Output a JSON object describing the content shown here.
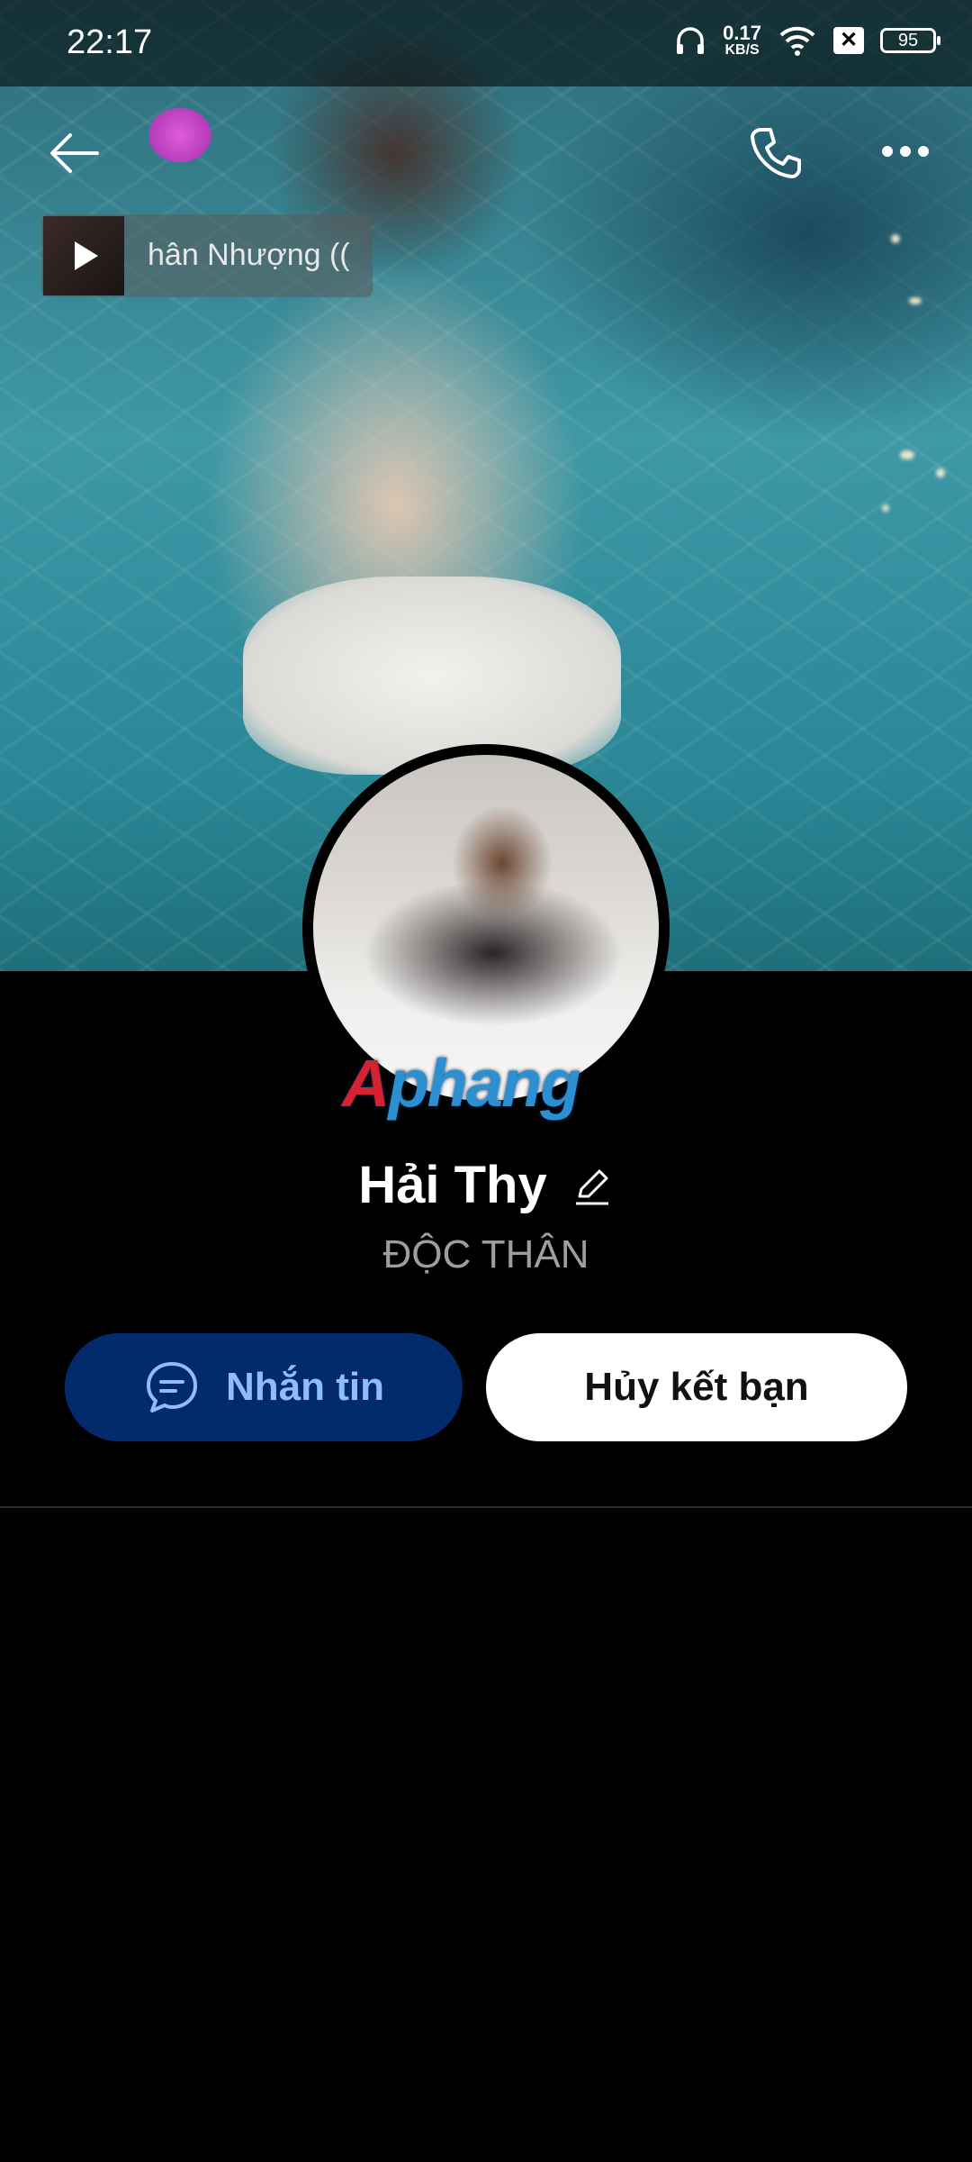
{
  "status_bar": {
    "time": "22:17",
    "net_speed_value": "0.17",
    "net_speed_unit": "KB/S",
    "battery": "95",
    "notification_icon": "x-box-icon"
  },
  "top_bar": {
    "back_icon": "arrow-left-icon",
    "call_icon": "phone-icon",
    "more_icon": "more-horizontal-icon"
  },
  "music_chip": {
    "title": "hân Nhượng (("
  },
  "profile": {
    "watermark_part1": "A",
    "watermark_part2": "phang",
    "name": "Hải Thy",
    "relationship_status": "ĐỘC THÂN"
  },
  "actions": {
    "message_label": "Nhắn tin",
    "unfriend_label": "Hủy kết bạn"
  },
  "colors": {
    "message_button_bg": "#042a6e",
    "message_button_text": "#8dbdff",
    "unfriend_button_bg": "#ffffff",
    "background": "#000000"
  }
}
